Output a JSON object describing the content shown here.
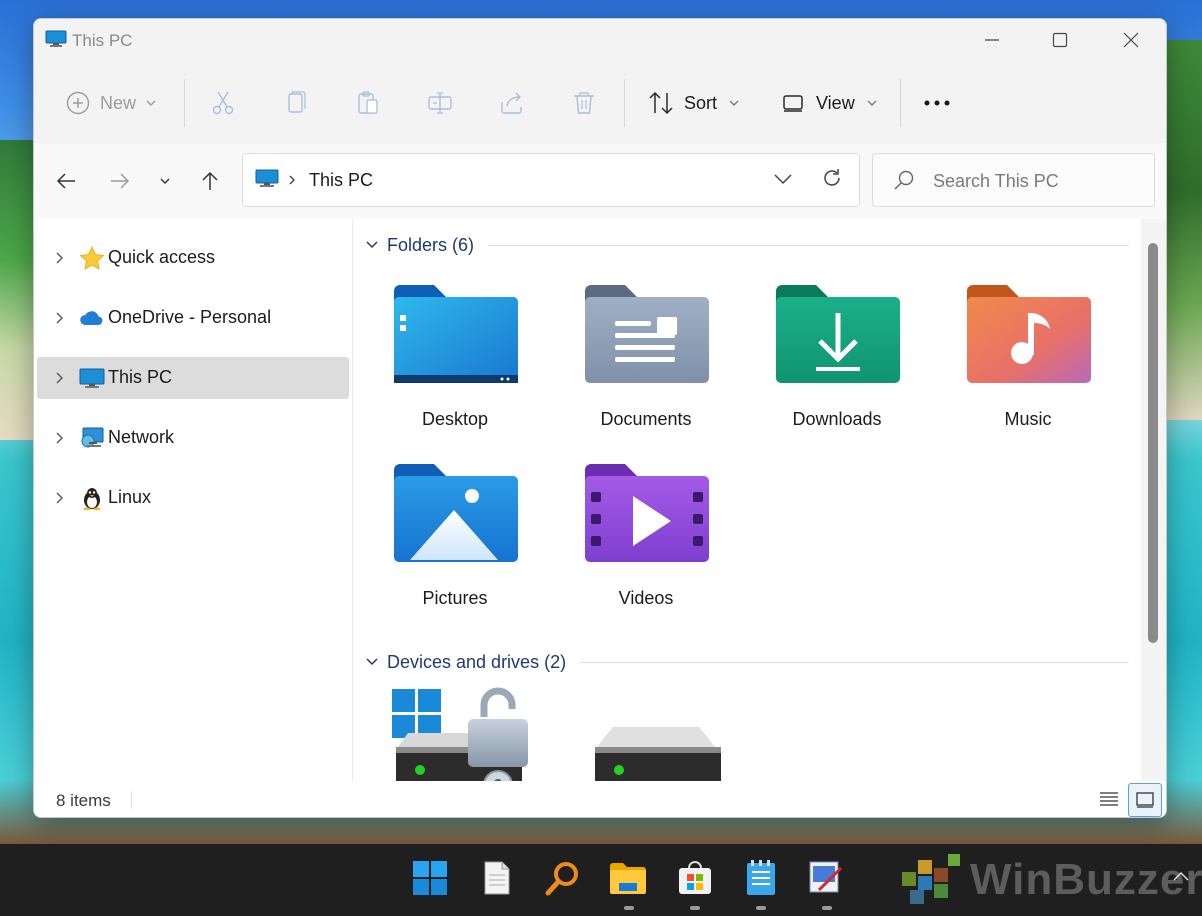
{
  "window": {
    "title": "This PC",
    "controls": [
      "minimize",
      "maximize",
      "close"
    ]
  },
  "toolbar": {
    "new_label": "New",
    "sort_label": "Sort",
    "view_label": "View",
    "actions": [
      "cut",
      "copy",
      "paste",
      "rename",
      "share",
      "delete"
    ]
  },
  "navigation": {
    "address": "This PC",
    "search_placeholder": "Search This PC"
  },
  "sidebar": {
    "items": [
      {
        "label": "Quick access",
        "icon": "star-icon",
        "selected": false
      },
      {
        "label": "OneDrive - Personal",
        "icon": "cloud-icon",
        "selected": false
      },
      {
        "label": "This PC",
        "icon": "monitor-icon",
        "selected": true
      },
      {
        "label": "Network",
        "icon": "network-icon",
        "selected": false
      },
      {
        "label": "Linux",
        "icon": "penguin-icon",
        "selected": false
      }
    ]
  },
  "content": {
    "folders_header": "Folders (6)",
    "folders": [
      {
        "label": "Desktop",
        "icon": "desktop-folder-icon"
      },
      {
        "label": "Documents",
        "icon": "documents-folder-icon"
      },
      {
        "label": "Downloads",
        "icon": "downloads-folder-icon"
      },
      {
        "label": "Music",
        "icon": "music-folder-icon"
      },
      {
        "label": "Pictures",
        "icon": "pictures-folder-icon"
      },
      {
        "label": "Videos",
        "icon": "videos-folder-icon"
      }
    ],
    "drives_header": "Devices and drives (2)",
    "drives": [
      {
        "icon": "windows-drive-unlocked-icon"
      },
      {
        "icon": "drive-icon"
      }
    ]
  },
  "status": {
    "item_count": "8 items"
  },
  "taskbar": {
    "apps": [
      "start-icon",
      "notepad-icon",
      "search-app-icon",
      "file-explorer-icon",
      "store-icon",
      "notes-icon",
      "paint-icon"
    ]
  },
  "watermark": {
    "text": "WinBuzzer"
  },
  "colors": {
    "accent": "#0067c0",
    "selection": "#dcdcdc",
    "group_header": "#1e3a6e"
  }
}
